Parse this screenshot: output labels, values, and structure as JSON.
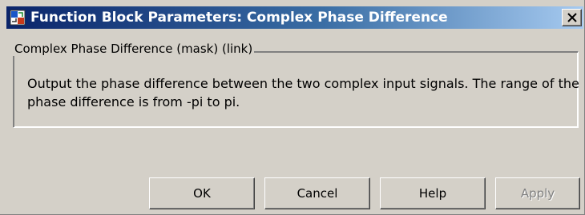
{
  "window": {
    "title": "Function Block Parameters: Complex Phase Difference"
  },
  "group": {
    "legend": "Complex Phase Difference (mask) (link)",
    "description": "Output the phase difference between the two complex input signals. The range of the phase difference is from -pi to pi."
  },
  "buttons": {
    "ok": "OK",
    "cancel": "Cancel",
    "help": "Help",
    "apply": "Apply"
  },
  "colors": {
    "titlebar_start": "#0a246a",
    "titlebar_end": "#a6caf0",
    "face": "#d4d0c8"
  },
  "icons": {
    "app": "simulink-block-icon",
    "close": "close-icon"
  }
}
